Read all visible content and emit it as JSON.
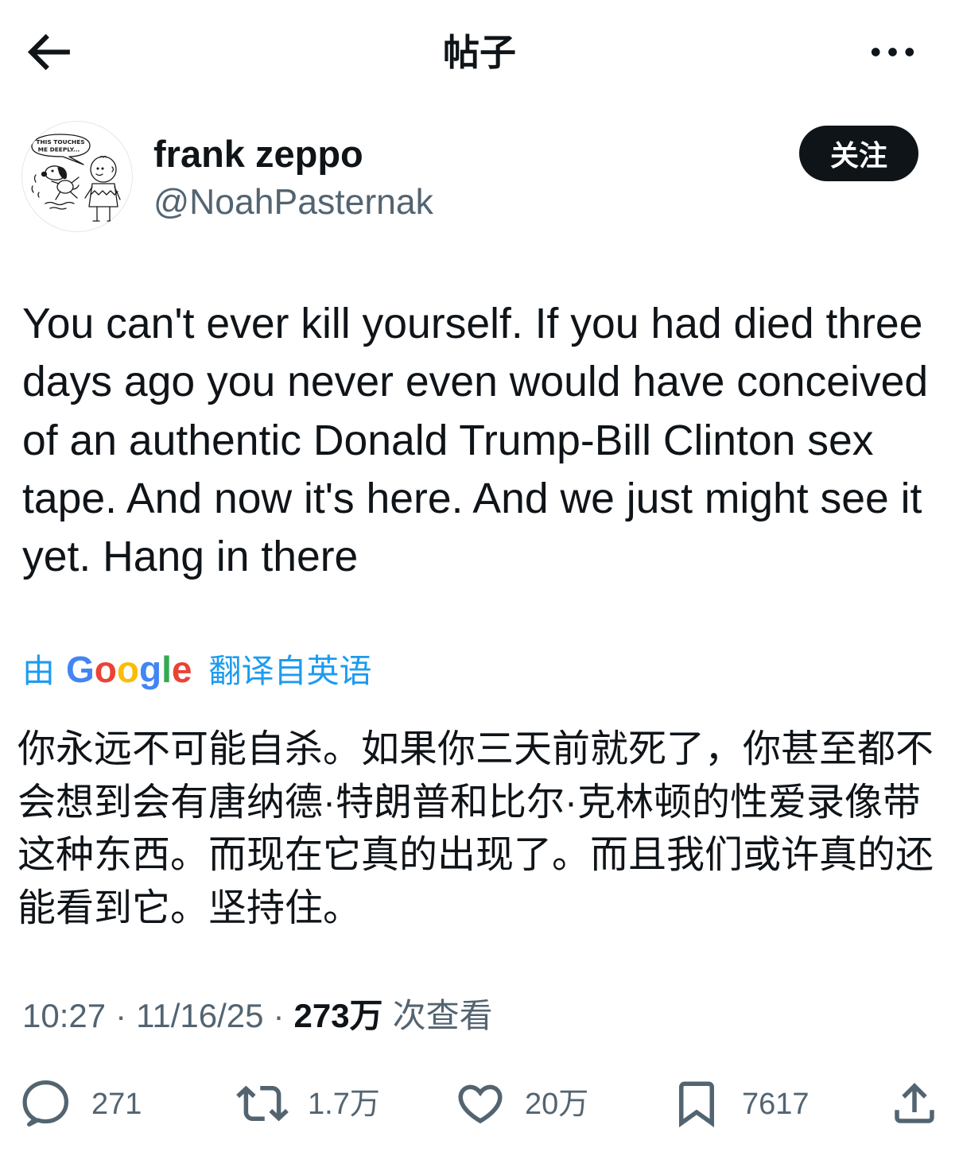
{
  "header": {
    "title": "帖子",
    "back_icon": "arrow-left-icon",
    "more_icon": "more-horizontal-icon"
  },
  "author": {
    "display_name": "frank zeppo",
    "handle": "@NoahPasternak",
    "follow_label": "关注",
    "avatar_bubble_lines": [
      "THIS TOUCHES",
      "ME DEEPLY..."
    ]
  },
  "tweet": {
    "text_lines": [
      "You can't ever kill yourself. If you had died three",
      "days ago you never even would have conceived",
      "of an authentic Donald Trump-Bill Clinton sex",
      "tape. And now it's here. And we just might see it",
      "yet. Hang in there"
    ],
    "translation": {
      "prefix": "由",
      "provider": "Google",
      "suffix": "翻译自英语",
      "text_lines": [
        "你永远不可能自杀。如果你三天前就死了，你甚至都不",
        "会想到会有唐纳德·特朗普和比尔·克林顿的性爱录像带",
        "这种东西。而现在它真的出现了。而且我们或许真的还",
        "能看到它。坚持住。"
      ]
    },
    "meta": {
      "time": "10:27",
      "separator": "·",
      "date": "11/16/25",
      "views_count": "273万",
      "views_label": "次查看"
    }
  },
  "actions": [
    {
      "icon": "reply-icon",
      "count": "271"
    },
    {
      "icon": "retweet-icon",
      "count": "1.7万"
    },
    {
      "icon": "heart-icon",
      "count": "20万"
    },
    {
      "icon": "bookmark-icon",
      "count": "7617"
    },
    {
      "icon": "share-icon"
    }
  ],
  "colors": {
    "text": "#0f1419",
    "secondary": "#536471",
    "link": "#1d9bf0",
    "button_bg": "#0f1419",
    "button_text": "#ffffff",
    "background": "#ffffff",
    "google_letters": [
      "#4285F4",
      "#EA4335",
      "#FBBC05",
      "#4285F4",
      "#34A853",
      "#EA4335"
    ]
  }
}
